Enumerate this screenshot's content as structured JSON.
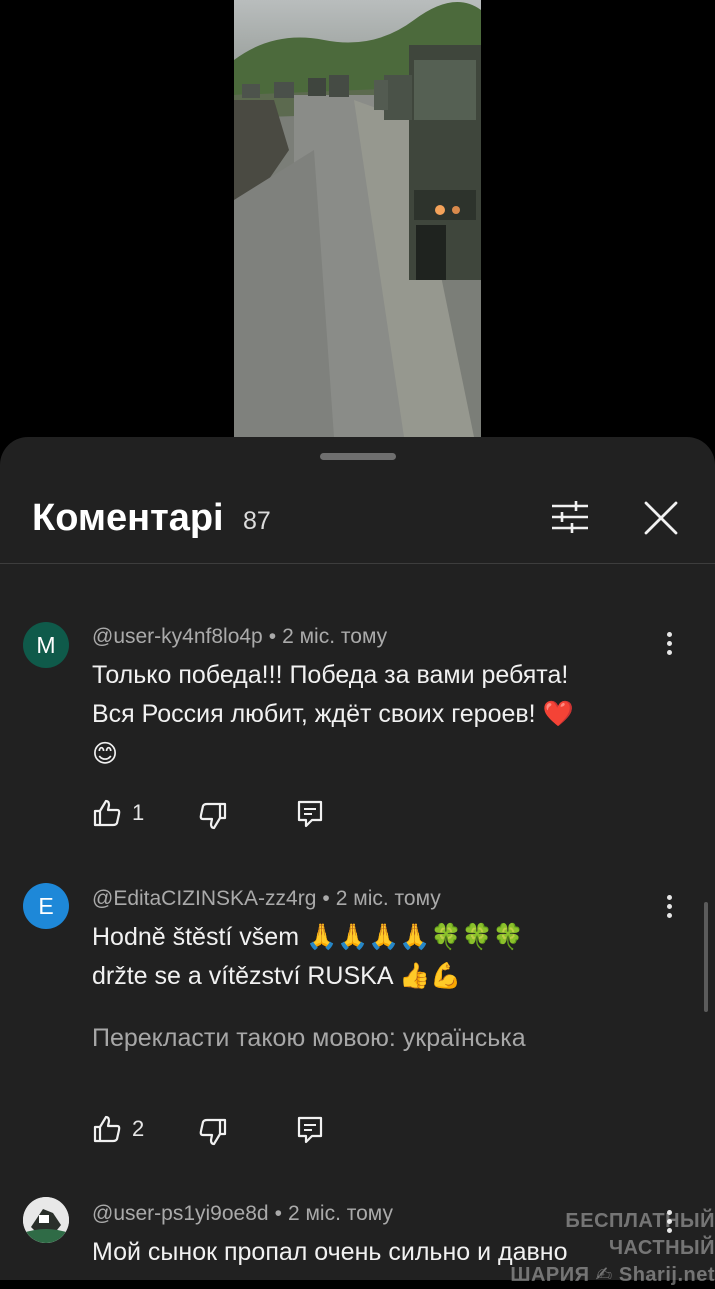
{
  "header": {
    "title": "Коментарі",
    "count": "87"
  },
  "comments": [
    {
      "avatar_letter": "M",
      "avatar_color": "#0f5a4a",
      "author": "@user-ky4nf8lo4p",
      "time": "2 міс. тому",
      "line1": "Только победа!!! Победа за вами ребята!",
      "line2": "Вся Россия любит, ждёт своих героев! ❤️",
      "line3": "😊",
      "likes": "1"
    },
    {
      "avatar_letter": "E",
      "avatar_color": "#1e88d8",
      "author": "@EditaCIZINSKA-zz4rg",
      "time": "2 міс. тому",
      "line1": "Hodně štěstí všem 🙏🙏🙏🙏🍀🍀🍀",
      "line2": "držte se a vítězství RUSKA 👍💪",
      "translate": "Перекласти такою мовою: українська",
      "likes": "2"
    },
    {
      "author": "@user-ps1yi9oe8d",
      "time": "2 міс. тому",
      "line1": "Мой сынок пропал очень сильно и давно"
    }
  ],
  "watermark": {
    "line1": "БЕСПЛАТНЫЙ ЧАСТНЫЙ",
    "line2": "ШАРИЯ ✍ Sharij.net"
  },
  "icons": [
    "sliders-icon",
    "close-icon",
    "more-vert-icon",
    "thumb-up-icon",
    "thumb-down-icon",
    "reply-icon"
  ]
}
